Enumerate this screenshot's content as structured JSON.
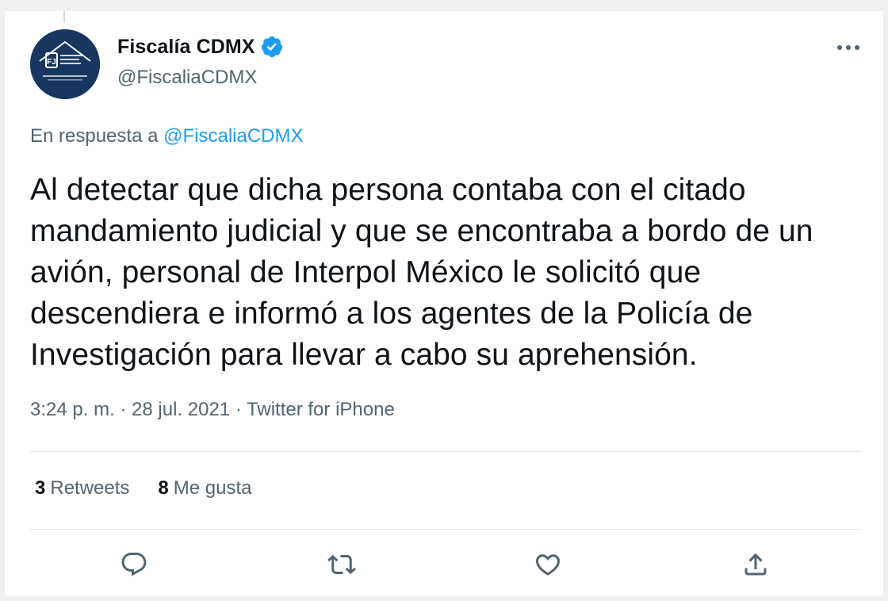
{
  "tweet": {
    "author_name": "Fiscalía CDMX",
    "handle": "@FiscaliaCDMX",
    "reply_prefix": "En respuesta a",
    "reply_mention": "@FiscaliaCDMX",
    "text": "Al detectar que dicha persona contaba con el citado mandamiento judicial y que se encontraba a bordo de un avión, personal de Interpol México le solicitó que descendiera e informó a los agentes de la Policía de Investigación para llevar a cabo su aprehensión.",
    "meta": "3:24 p. m. · 28 jul. 2021 · Twitter for iPhone",
    "retweets_count": "3",
    "retweets_label": "Retweets",
    "likes_count": "8",
    "likes_label": "Me gusta"
  },
  "icons": {
    "verified": "verified-badge-icon",
    "more": "more-options-icon",
    "reply": "reply-icon",
    "retweet": "retweet-icon",
    "like": "like-icon",
    "share": "share-icon"
  },
  "colors": {
    "accent": "#1d9bf0",
    "secondary_text": "#536471",
    "primary_text": "#0f1419",
    "avatar_bg": "#173760"
  }
}
